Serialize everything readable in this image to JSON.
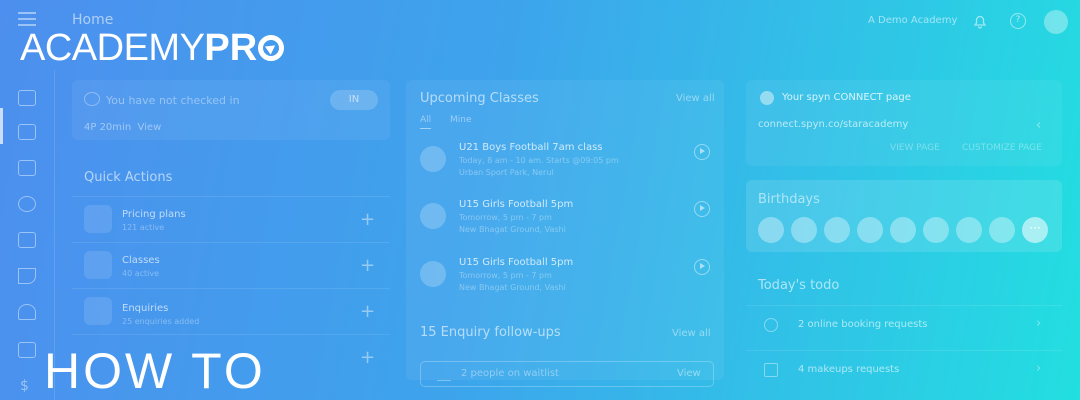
{
  "brand": {
    "logo_part1": "ACADEMY",
    "logo_part2": "PR"
  },
  "header": {
    "title": "Home",
    "academy_name": "A Demo Academy"
  },
  "overlay": {
    "howto": "HOW TO"
  },
  "checkin": {
    "status": "You have not checked in",
    "button": "IN",
    "duration": "4P  20min",
    "view": "View"
  },
  "quick_actions": {
    "title": "Quick Actions",
    "items": [
      {
        "label": "Pricing plans",
        "sub": "121 active"
      },
      {
        "label": "Classes",
        "sub": "40 active"
      },
      {
        "label": "Enquiries",
        "sub": "25 enquiries added"
      },
      {
        "label": "",
        "sub": ""
      }
    ]
  },
  "upcoming": {
    "title": "Upcoming Classes",
    "view_all": "View all",
    "tabs": [
      "All",
      "Mine"
    ],
    "classes": [
      {
        "name": "U21 Boys Football 7am class",
        "time": "Today, 8 am - 10 am. Starts @09:05 pm",
        "location": "Urban Sport Park, Nerul"
      },
      {
        "name": "U15 Girls Football 5pm",
        "time": "Tomorrow, 5 pm - 7 pm",
        "location": "New Bhagat Ground, Vashi"
      },
      {
        "name": "U15 Girls Football 5pm",
        "time": "Tomorrow, 5 pm - 7 pm",
        "location": "New Bhagat Ground, Vashi"
      }
    ]
  },
  "enquiry": {
    "title": "15 Enquiry follow-ups",
    "view_all": "View all",
    "waitlist": "2 people on waitlist",
    "view": "View"
  },
  "connect": {
    "title": "Your spyn CONNECT page",
    "url": "connect.spyn.co/staracademy",
    "view_page": "VIEW PAGE",
    "customize": "CUSTOMIZE PAGE"
  },
  "birthdays": {
    "title": "Birthdays",
    "more": "···"
  },
  "todo": {
    "title": "Today's todo",
    "items": [
      {
        "label": "2 online booking requests"
      },
      {
        "label": "4 makeups requests"
      }
    ]
  },
  "misc": {
    "dollar": "$",
    "help": "?"
  }
}
